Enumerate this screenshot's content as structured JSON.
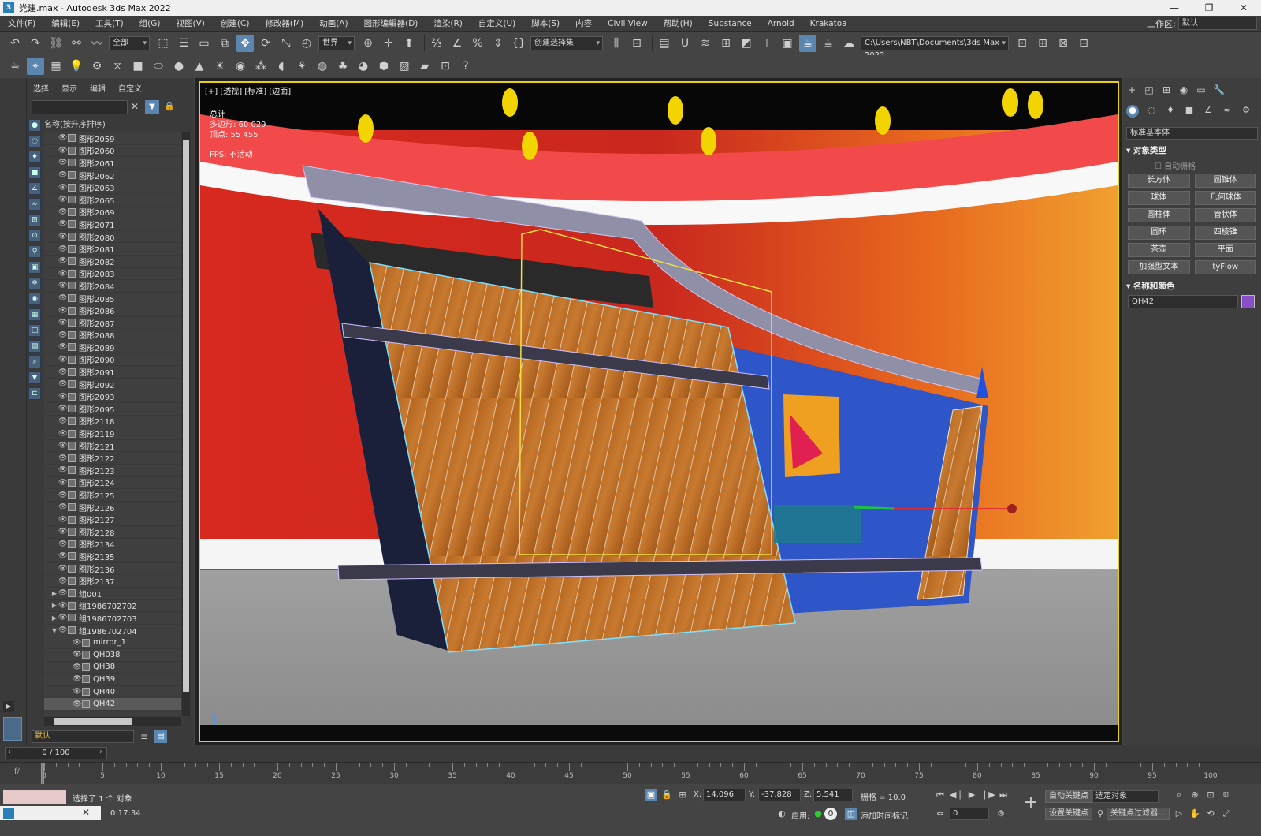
{
  "window": {
    "title": "党建.max - Autodesk 3ds Max 2022",
    "controls": [
      "—",
      "❐",
      "✕"
    ]
  },
  "menu": {
    "items": [
      "文件(F)",
      "编辑(E)",
      "工具(T)",
      "组(G)",
      "视图(V)",
      "创建(C)",
      "修改器(M)",
      "动画(A)",
      "图形编辑器(D)",
      "渲染(R)",
      "自定义(U)",
      "脚本(S)",
      "内容",
      "Civil View",
      "帮助(H)",
      "Substance",
      "Arnold",
      "Krakatoa"
    ],
    "workspace_label": "工作区:",
    "workspace_value": "默认"
  },
  "toolbar": {
    "filter_value": "全部",
    "coord_system": "世界",
    "selection_set": "创建选择集",
    "project_path": "C:\\Users\\NBT\\Documents\\3ds Max 2022"
  },
  "scene_explorer": {
    "tabs": [
      "选择",
      "显示",
      "编辑",
      "自定义"
    ],
    "column_header": "名称(按升序排序)",
    "rows": [
      {
        "name": "图形2059",
        "exp": ""
      },
      {
        "name": "图形2060",
        "exp": ""
      },
      {
        "name": "图形2061",
        "exp": ""
      },
      {
        "name": "图形2062",
        "exp": ""
      },
      {
        "name": "图形2063",
        "exp": ""
      },
      {
        "name": "图形2065",
        "exp": ""
      },
      {
        "name": "图形2069",
        "exp": ""
      },
      {
        "name": "图形2071",
        "exp": ""
      },
      {
        "name": "图形2080",
        "exp": ""
      },
      {
        "name": "图形2081",
        "exp": ""
      },
      {
        "name": "图形2082",
        "exp": ""
      },
      {
        "name": "图形2083",
        "exp": ""
      },
      {
        "name": "图形2084",
        "exp": ""
      },
      {
        "name": "图形2085",
        "exp": ""
      },
      {
        "name": "图形2086",
        "exp": ""
      },
      {
        "name": "图形2087",
        "exp": ""
      },
      {
        "name": "图形2088",
        "exp": ""
      },
      {
        "name": "图形2089",
        "exp": ""
      },
      {
        "name": "图形2090",
        "exp": ""
      },
      {
        "name": "图形2091",
        "exp": ""
      },
      {
        "name": "图形2092",
        "exp": ""
      },
      {
        "name": "图形2093",
        "exp": ""
      },
      {
        "name": "图形2095",
        "exp": ""
      },
      {
        "name": "图形2118",
        "exp": ""
      },
      {
        "name": "图形2119",
        "exp": ""
      },
      {
        "name": "图形2121",
        "exp": ""
      },
      {
        "name": "图形2122",
        "exp": ""
      },
      {
        "name": "图形2123",
        "exp": ""
      },
      {
        "name": "图形2124",
        "exp": ""
      },
      {
        "name": "图形2125",
        "exp": ""
      },
      {
        "name": "图形2126",
        "exp": ""
      },
      {
        "name": "图形2127",
        "exp": ""
      },
      {
        "name": "图形2128",
        "exp": ""
      },
      {
        "name": "图形2134",
        "exp": ""
      },
      {
        "name": "图形2135",
        "exp": ""
      },
      {
        "name": "图形2136",
        "exp": ""
      },
      {
        "name": "图形2137",
        "exp": ""
      },
      {
        "name": "组001",
        "exp": "▶"
      },
      {
        "name": "组1986702702",
        "exp": "▶"
      },
      {
        "name": "组1986702703",
        "exp": "▶"
      },
      {
        "name": "组1986702704",
        "exp": "▼"
      },
      {
        "name": "mirror_1",
        "exp": " "
      },
      {
        "name": "QH038",
        "exp": " "
      },
      {
        "name": "QH38",
        "exp": " "
      },
      {
        "name": "QH39",
        "exp": " "
      },
      {
        "name": "QH40",
        "exp": " "
      },
      {
        "name": "QH42",
        "exp": " "
      }
    ],
    "layer": "默认"
  },
  "viewport": {
    "label": "[+] [透视] [标准] [边面]",
    "stats_total": "总计",
    "stats_polys": "多边形: 60 029",
    "stats_verts": "顶点: 55 455",
    "stats_fps": "FPS: 不活动"
  },
  "command_panel": {
    "category": "标准基本体",
    "section_object_type": "对象类型",
    "autogrid": "自动栅格",
    "buttons": [
      "长方体",
      "圆锥体",
      "球体",
      "几何球体",
      "圆柱体",
      "管状体",
      "圆环",
      "四棱锥",
      "茶壶",
      "平面",
      "加强型文本",
      "tyFlow"
    ],
    "section_name_color": "名称和颜色",
    "object_name": "QH42",
    "object_color": "#8a4fc8"
  },
  "timeline": {
    "frame_display": "0 / 100",
    "ticks": [
      "0",
      "5",
      "10",
      "15",
      "20",
      "25",
      "30",
      "35",
      "40",
      "45",
      "50",
      "55",
      "60",
      "65",
      "70",
      "75",
      "80",
      "85",
      "90",
      "95",
      "100"
    ]
  },
  "status": {
    "selection": "选择了 1 个 对象",
    "time": "0:17:34",
    "x_label": "X:",
    "x_value": "14.096",
    "y_label": "Y:",
    "y_value": "-37.828",
    "z_label": "Z:",
    "z_value": "5.541",
    "grid": "栅格 = 10.0",
    "enable_label": "启用:",
    "add_time_tag": "添加时间标记",
    "auto_key": "自动关键点",
    "set_key": "设置关键点",
    "selected_object": "选定对象",
    "key_filters": "关键点过滤器...",
    "frame_value": "0"
  }
}
